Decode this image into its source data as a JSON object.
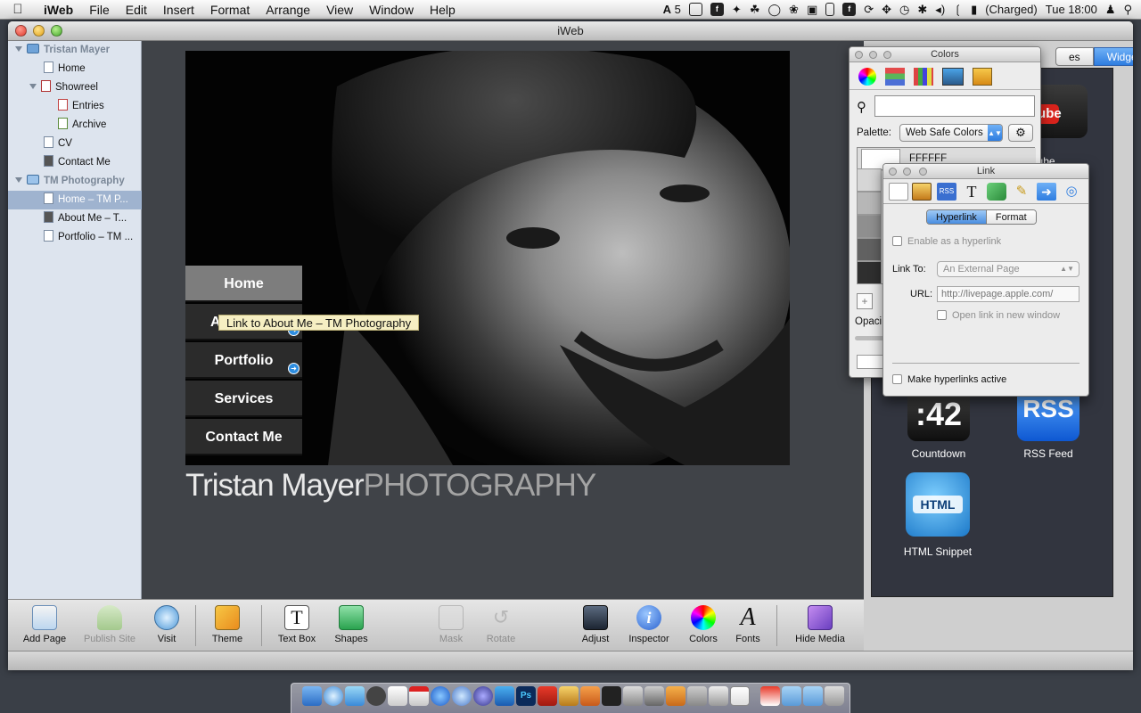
{
  "menubar": {
    "app": "iWeb",
    "items": [
      "File",
      "Edit",
      "Insert",
      "Format",
      "Arrange",
      "View",
      "Window",
      "Help"
    ],
    "status": {
      "adobe_count": "5",
      "battery": "(Charged)",
      "clock": "Tue 18:00"
    }
  },
  "window": {
    "title": "iWeb"
  },
  "sidebar": {
    "site1": "Tristan Mayer",
    "home": "Home",
    "showreel": "Showreel",
    "entries": "Entries",
    "archive": "Archive",
    "cv": "CV",
    "contact": "Contact Me",
    "site2": "TM Photography",
    "tm_home": "Home – TM P...",
    "tm_about": "About Me – T...",
    "tm_portfolio": "Portfolio – TM ..."
  },
  "page": {
    "nav": [
      "Home",
      "About Me",
      "Portfolio",
      "Services",
      "Contact Me"
    ],
    "nav_about_visible": "A",
    "tooltip": "Link to About Me – TM Photography",
    "title_main": "Tristan Mayer",
    "title_accent": "PHOTOGRAPHY"
  },
  "media": {
    "tab_visible": "es",
    "tab_widgets": "Widgets",
    "widgets": {
      "youtube_icon_text": "Tube",
      "youtube_label": "uTube",
      "countdown_icon_text": ":42",
      "countdown_label": "Countdown",
      "rss_icon_text": "RSS",
      "rss_label": "RSS Feed",
      "html_icon_text": "HTML",
      "html_label": "HTML Snippet"
    }
  },
  "toolbar": {
    "add_page": "Add Page",
    "publish_site": "Publish Site",
    "visit": "Visit",
    "theme": "Theme",
    "text_box": "Text Box",
    "shapes": "Shapes",
    "mask": "Mask",
    "rotate": "Rotate",
    "adjust": "Adjust",
    "inspector": "Inspector",
    "colors": "Colors",
    "fonts": "Fonts",
    "hide_media": "Hide Media"
  },
  "colors_panel": {
    "title": "Colors",
    "palette_label": "Palette:",
    "palette_value": "Web Safe Colors",
    "selected_hex": "FFFFFF",
    "opacity_label": "Opaci",
    "swatches": [
      "#d6d6d6",
      "#b7b7b7",
      "#8f8f8f",
      "#616161",
      "#2f2f2f",
      "#000000"
    ]
  },
  "link_panel": {
    "title": "Link",
    "tab_hyperlink": "Hyperlink",
    "tab_format": "Format",
    "enable_label": "Enable as a hyperlink",
    "link_to_label": "Link To:",
    "link_to_value": "An External Page",
    "url_label": "URL:",
    "url_placeholder": "http://livepage.apple.com/",
    "new_window_label": "Open link in new window",
    "make_active_label": "Make hyperlinks active"
  },
  "colors": {
    "accent": "#2e7de0",
    "nav_active": "#7d7d7d",
    "canvas_bg": "#404348"
  }
}
